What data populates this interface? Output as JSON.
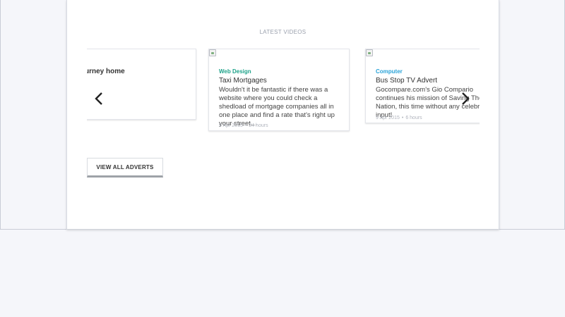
{
  "section": {
    "title": "LATEST VIDEOS"
  },
  "cards": [
    {
      "title": "urney home"
    },
    {
      "category": "Web Design",
      "category_color": "#1ea38a",
      "title": "Taxi Mortgages",
      "excerpt": "Wouldn't it be fantastic if there was a website where you could check a shedload of mortgage companies all in one place and find a rate that's right up your street…",
      "date": "9 Apr 2015",
      "age": "24 hours"
    },
    {
      "category": "Computer",
      "category_color": "#2aa3d8",
      "title": "Bus Stop TV Advert",
      "excerpt": "Gocompare.com's Gio Compario continues his mission of Saving The Nation, this time without any celebrity input!",
      "date": "9 Apr 2015",
      "age": "6 hours"
    }
  ],
  "carousel": {
    "prev_icon": "chevron-left-icon",
    "next_icon": "chevron-right-icon"
  },
  "actions": {
    "view_all_label": "VIEW ALL ADVERTS"
  }
}
